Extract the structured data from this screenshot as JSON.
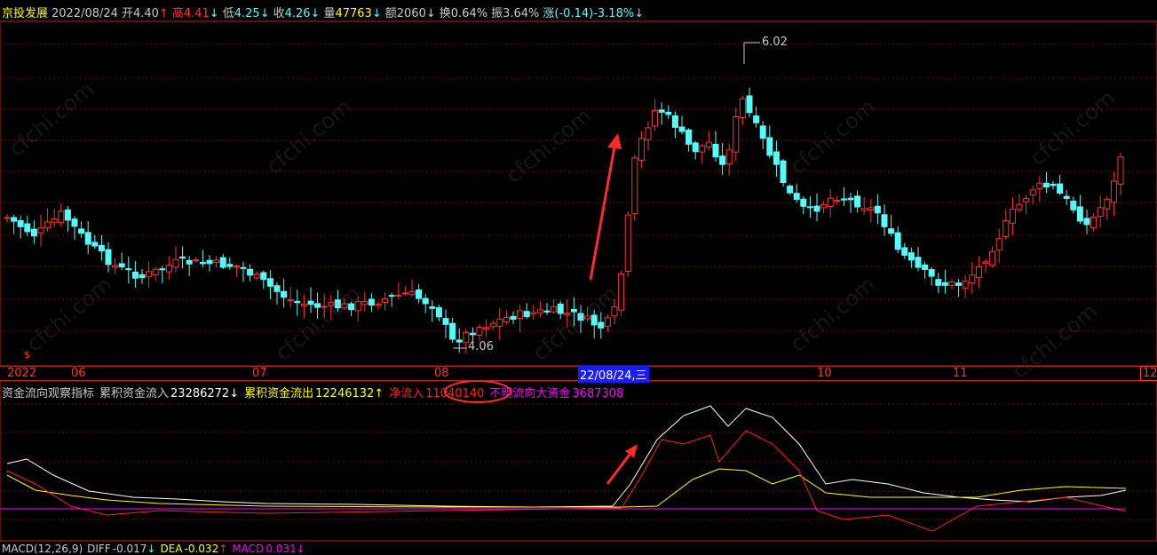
{
  "header": {
    "name": "京投发展",
    "date": "2022/08/24",
    "open_label": "开",
    "open": "4.40",
    "open_arrow": "↑",
    "high_label": "高",
    "high": "4.41",
    "high_arrow": "↓",
    "low_label": "低",
    "low": "4.25",
    "low_arrow": "↓",
    "close_label": "收",
    "close": "4.26",
    "close_arrow": "↓",
    "vol_label": "量",
    "vol": "47763",
    "vol_arrow": "↓",
    "amt_label": "额",
    "amt": "2060",
    "amt_arrow": "↓",
    "turnover_label": "换",
    "turnover": "0.64%",
    "amp_label": "振",
    "amp": "3.64%",
    "chg_label": "涨",
    "chg": "(-0.14)-3.18%",
    "chg_arrow": "↓"
  },
  "price_chart": {
    "high_marker": "6.02",
    "low_marker": "4.06",
    "up_color": "#ff3232",
    "down_color": "#54fcfc",
    "grid_color": "#8b0000"
  },
  "date_axis": {
    "labels": [
      "2022",
      "06",
      "07",
      "08",
      "10",
      "11",
      "12"
    ],
    "cursor": "22/08/24,三",
    "marker": "$"
  },
  "indicator": {
    "name": "资金流向观察指标",
    "inflow_label": "累积资金流入",
    "inflow": "23286272",
    "inflow_arrow": "↓",
    "outflow_label": "累积资金流出",
    "outflow": "12246132",
    "outflow_arrow": "↑",
    "net_label": "净流入",
    "net": "11040140",
    "unknown_label": "不明流向大资金",
    "unknown": "3687308",
    "colors": {
      "inflow": "#ffffff",
      "outflow": "#ffff00",
      "net": "#ff2020",
      "unknown": "#ff00ff"
    }
  },
  "macd": {
    "name": "MACD(12,26,9)",
    "diff_label": "DIFF",
    "diff": "-0.017",
    "diff_arrow": "↓",
    "dea_label": "DEA",
    "dea": "-0.032",
    "dea_arrow": "↑",
    "macd_label": "MACD",
    "macd": "0.031",
    "macd_arrow": "↓"
  },
  "watermark": "cfchi.com"
}
